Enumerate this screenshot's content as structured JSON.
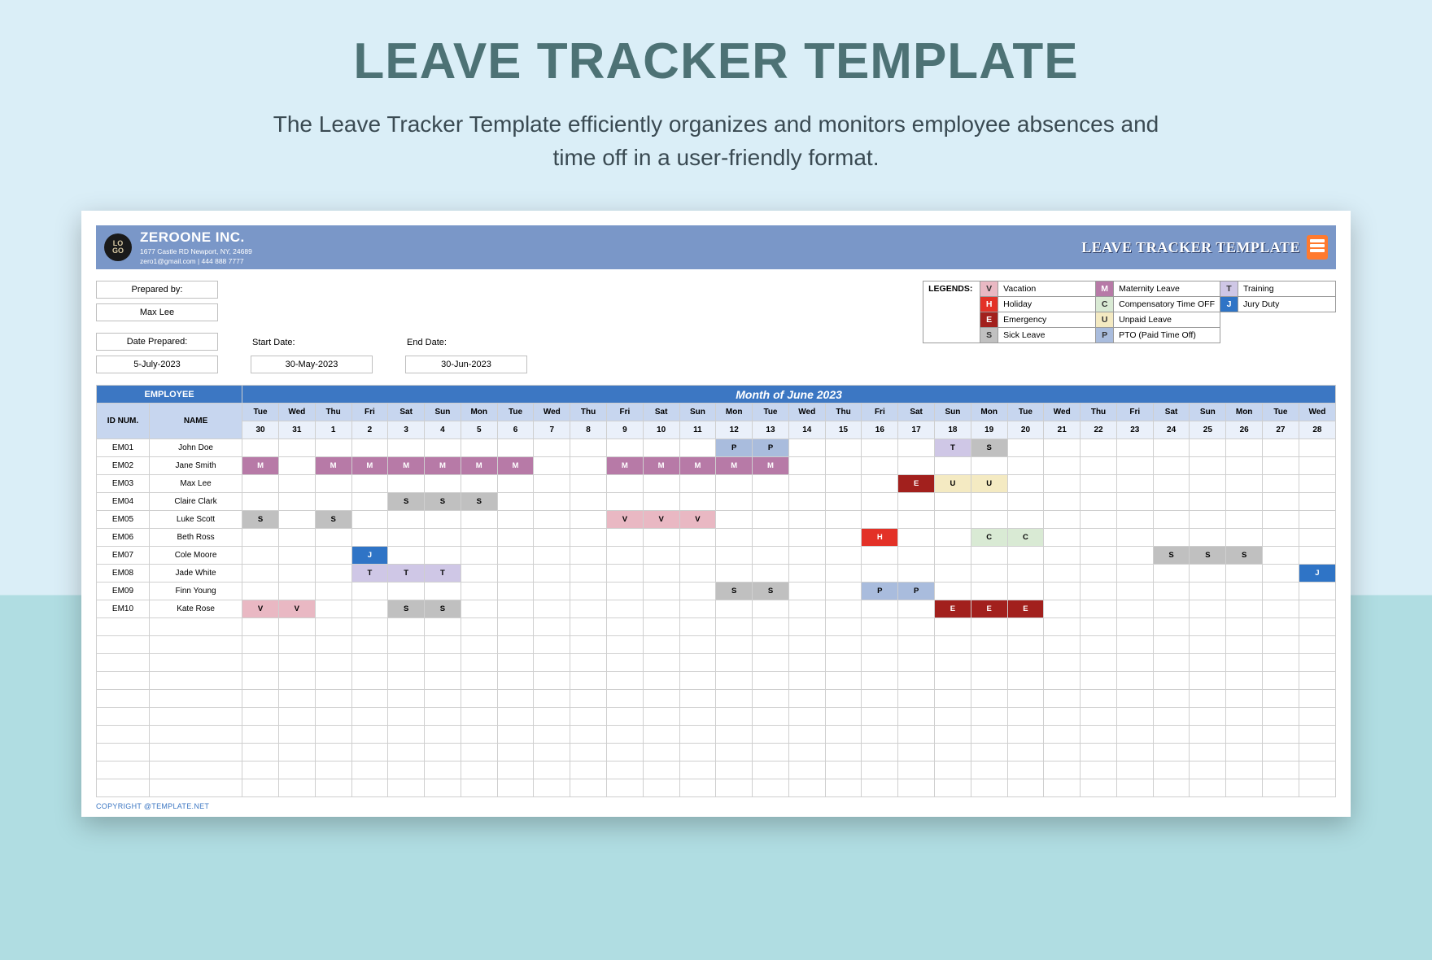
{
  "page": {
    "title": "LEAVE TRACKER TEMPLATE",
    "subtitle": "The Leave Tracker Template efficiently organizes and monitors employee absences and time off in a user-friendly format."
  },
  "banner": {
    "logo_top": "LO",
    "logo_bot": "GO",
    "company": "ZEROONE INC.",
    "address": "1677 Castle RD Newport, NY, 24689",
    "contact": "zero1@gmail.com | 444 888 7777",
    "right_title": "LEAVE TRACKER TEMPLATE"
  },
  "meta": {
    "prepared_by_label": "Prepared by:",
    "prepared_by": "Max Lee",
    "date_prepared_label": "Date Prepared:",
    "date_prepared": "5-July-2023",
    "start_label": "Start Date:",
    "start": "30-May-2023",
    "end_label": "End Date:",
    "end": "30-Jun-2023"
  },
  "legend": {
    "header": "LEGENDS:",
    "rows": [
      [
        {
          "k": "V",
          "c": "c-V",
          "t": "Vacation"
        },
        {
          "k": "M",
          "c": "c-M",
          "t": "Maternity Leave"
        },
        {
          "k": "T",
          "c": "c-T",
          "t": "Training"
        }
      ],
      [
        {
          "k": "H",
          "c": "c-H",
          "t": "Holiday"
        },
        {
          "k": "C",
          "c": "c-C",
          "t": "Compensatory Time OFF"
        },
        {
          "k": "J",
          "c": "c-J",
          "t": "Jury Duty"
        }
      ],
      [
        {
          "k": "E",
          "c": "c-E",
          "t": "Emergency"
        },
        {
          "k": "U",
          "c": "c-U",
          "t": "Unpaid Leave"
        }
      ],
      [
        {
          "k": "S",
          "c": "c-S",
          "t": "Sick Leave"
        },
        {
          "k": "P",
          "c": "c-P",
          "t": "PTO (Paid Time Off)"
        }
      ]
    ]
  },
  "grid": {
    "employee_header": "EMPLOYEE",
    "month_header": "Month of  June 2023",
    "id_header": "ID NUM.",
    "name_header": "NAME",
    "dow": [
      "Tue",
      "Wed",
      "Thu",
      "Fri",
      "Sat",
      "Sun",
      "Mon",
      "Tue",
      "Wed",
      "Thu",
      "Fri",
      "Sat",
      "Sun",
      "Mon",
      "Tue",
      "Wed",
      "Thu",
      "Fri",
      "Sat",
      "Sun",
      "Mon",
      "Tue",
      "Wed",
      "Thu",
      "Fri",
      "Sat",
      "Sun",
      "Mon",
      "Tue",
      "Wed"
    ],
    "dates": [
      "30",
      "31",
      "1",
      "2",
      "3",
      "4",
      "5",
      "6",
      "7",
      "8",
      "9",
      "10",
      "11",
      "12",
      "13",
      "14",
      "15",
      "16",
      "17",
      "18",
      "19",
      "20",
      "21",
      "22",
      "23",
      "24",
      "25",
      "26",
      "27",
      "28"
    ],
    "employees": [
      {
        "id": "EM01",
        "name": "John Doe",
        "leaves": {
          "13": "P",
          "14": "P",
          "19": "T",
          "20": "S"
        }
      },
      {
        "id": "EM02",
        "name": "Jane Smith",
        "leaves": {
          "0": "M",
          "2": "M",
          "3": "M",
          "4": "M",
          "5": "M",
          "6": "M",
          "7": "M",
          "10": "M",
          "11": "M",
          "12": "M",
          "13": "M",
          "14": "M"
        }
      },
      {
        "id": "EM03",
        "name": "Max Lee",
        "leaves": {
          "18": "E",
          "19": "U",
          "20": "U"
        }
      },
      {
        "id": "EM04",
        "name": "Claire Clark",
        "leaves": {
          "4": "S",
          "5": "S",
          "6": "S"
        }
      },
      {
        "id": "EM05",
        "name": "Luke Scott",
        "leaves": {
          "0": "S",
          "2": "S",
          "10": "V",
          "11": "V",
          "12": "V"
        }
      },
      {
        "id": "EM06",
        "name": "Beth Ross",
        "leaves": {
          "17": "H",
          "20": "C",
          "21": "C"
        }
      },
      {
        "id": "EM07",
        "name": "Cole Moore",
        "leaves": {
          "3": "J",
          "25": "S",
          "26": "S",
          "27": "S"
        }
      },
      {
        "id": "EM08",
        "name": "Jade White",
        "leaves": {
          "3": "T",
          "4": "T",
          "5": "T",
          "29": "J"
        }
      },
      {
        "id": "EM09",
        "name": "Finn Young",
        "leaves": {
          "13": "S",
          "14": "S",
          "17": "P",
          "18": "P"
        }
      },
      {
        "id": "EM10",
        "name": "Kate Rose",
        "leaves": {
          "0": "V",
          "1": "V",
          "4": "S",
          "5": "S",
          "19": "E",
          "20": "E",
          "21": "E"
        }
      }
    ],
    "blank_rows": 10
  },
  "copyright": "COPYRIGHT @TEMPLATE.NET"
}
